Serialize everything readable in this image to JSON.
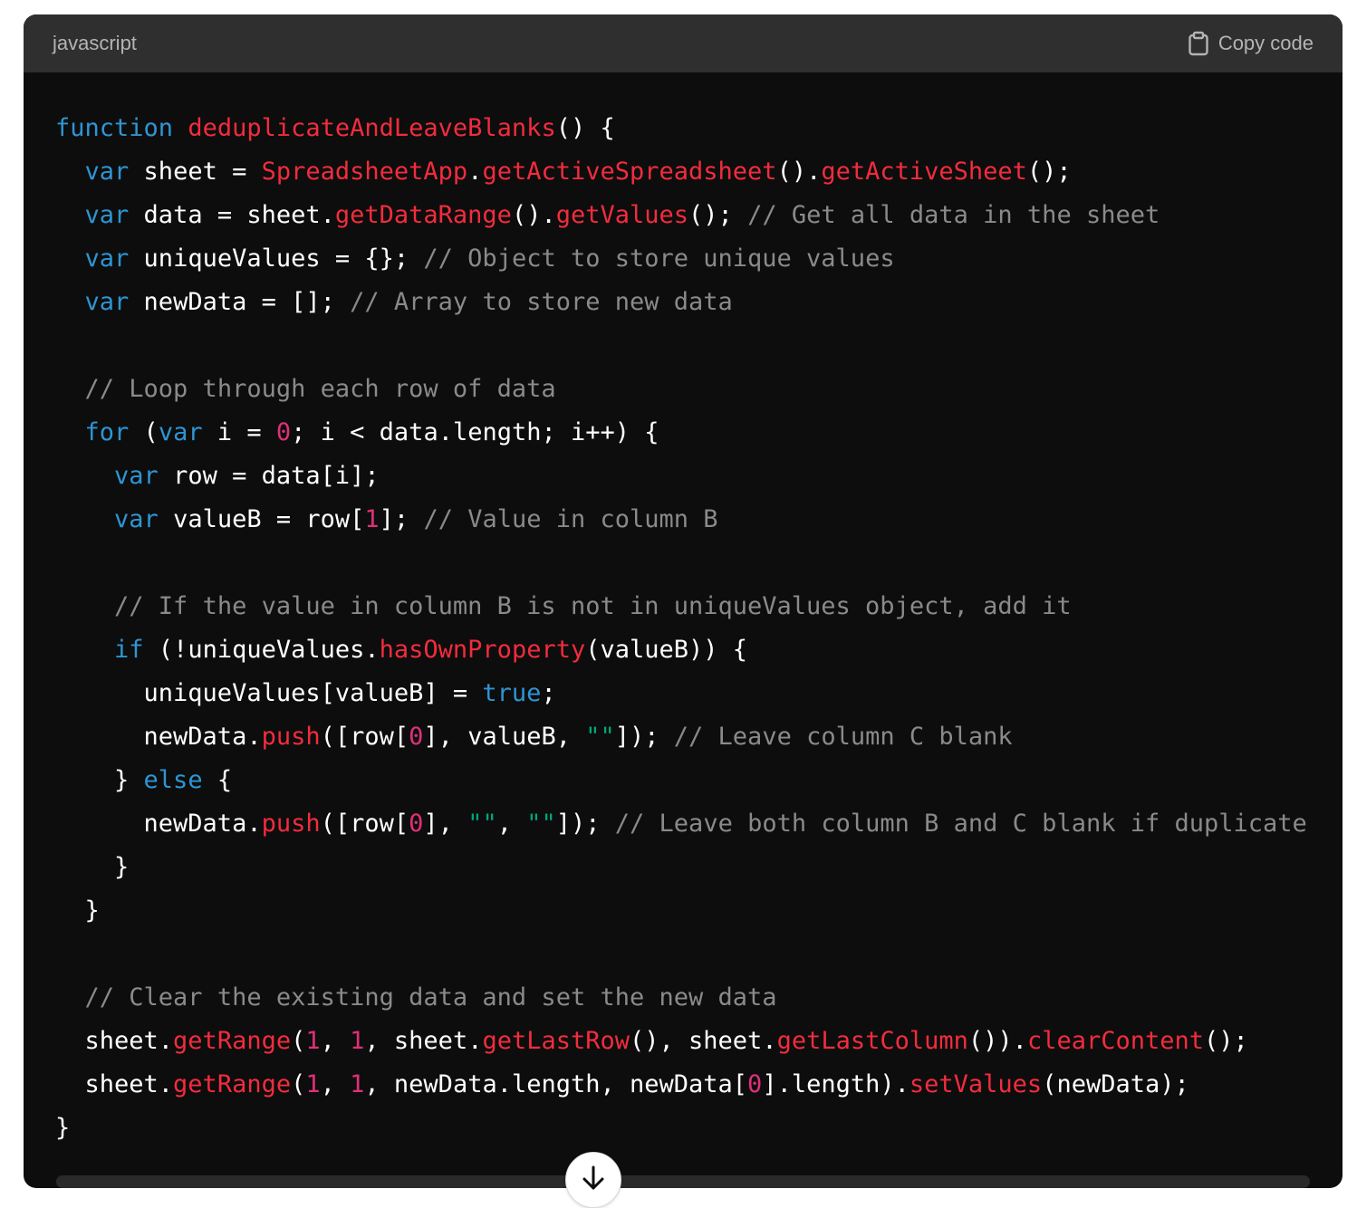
{
  "header": {
    "language": "javascript",
    "copy_label": "Copy code",
    "copy_icon": "clipboard-icon"
  },
  "colors": {
    "keyword": "#2e95d3",
    "function": "#f22c3d",
    "number": "#df3079",
    "string": "#00a67d",
    "comment": "#8a8a8a",
    "plain": "#ffffff",
    "header_bg": "#2f2f2f",
    "code_bg": "#0d0d0d"
  },
  "code_lines": [
    [
      [
        "kw",
        "function"
      ],
      [
        "p",
        " "
      ],
      [
        "fn",
        "deduplicateAndLeaveBlanks"
      ],
      [
        "p",
        "() {"
      ]
    ],
    [
      [
        "p",
        "  "
      ],
      [
        "kw",
        "var"
      ],
      [
        "p",
        " sheet = "
      ],
      [
        "fn",
        "SpreadsheetApp"
      ],
      [
        "p",
        "."
      ],
      [
        "fn",
        "getActiveSpreadsheet"
      ],
      [
        "p",
        "()."
      ],
      [
        "fn",
        "getActiveSheet"
      ],
      [
        "p",
        "();"
      ]
    ],
    [
      [
        "p",
        "  "
      ],
      [
        "kw",
        "var"
      ],
      [
        "p",
        " data = sheet."
      ],
      [
        "fn",
        "getDataRange"
      ],
      [
        "p",
        "()."
      ],
      [
        "fn",
        "getValues"
      ],
      [
        "p",
        "(); "
      ],
      [
        "com",
        "// Get all data in the sheet"
      ]
    ],
    [
      [
        "p",
        "  "
      ],
      [
        "kw",
        "var"
      ],
      [
        "p",
        " uniqueValues = {}; "
      ],
      [
        "com",
        "// Object to store unique values"
      ]
    ],
    [
      [
        "p",
        "  "
      ],
      [
        "kw",
        "var"
      ],
      [
        "p",
        " newData = []; "
      ],
      [
        "com",
        "// Array to store new data"
      ]
    ],
    [],
    [
      [
        "p",
        "  "
      ],
      [
        "com",
        "// Loop through each row of data"
      ]
    ],
    [
      [
        "p",
        "  "
      ],
      [
        "kw",
        "for"
      ],
      [
        "p",
        " ("
      ],
      [
        "kw",
        "var"
      ],
      [
        "p",
        " i = "
      ],
      [
        "num",
        "0"
      ],
      [
        "p",
        "; i < data.length; i++) {"
      ]
    ],
    [
      [
        "p",
        "    "
      ],
      [
        "kw",
        "var"
      ],
      [
        "p",
        " row = data[i];"
      ]
    ],
    [
      [
        "p",
        "    "
      ],
      [
        "kw",
        "var"
      ],
      [
        "p",
        " valueB = row["
      ],
      [
        "num",
        "1"
      ],
      [
        "p",
        "]; "
      ],
      [
        "com",
        "// Value in column B"
      ]
    ],
    [],
    [
      [
        "p",
        "    "
      ],
      [
        "com",
        "// If the value in column B is not in uniqueValues object, add it"
      ]
    ],
    [
      [
        "p",
        "    "
      ],
      [
        "kw",
        "if"
      ],
      [
        "p",
        " (!uniqueValues."
      ],
      [
        "fn",
        "hasOwnProperty"
      ],
      [
        "p",
        "(valueB)) {"
      ]
    ],
    [
      [
        "p",
        "      uniqueValues[valueB] = "
      ],
      [
        "kw",
        "true"
      ],
      [
        "p",
        ";"
      ]
    ],
    [
      [
        "p",
        "      newData."
      ],
      [
        "fn",
        "push"
      ],
      [
        "p",
        "([row["
      ],
      [
        "num",
        "0"
      ],
      [
        "p",
        "], valueB, "
      ],
      [
        "str",
        "\"\""
      ],
      [
        "p",
        "]); "
      ],
      [
        "com",
        "// Leave column C blank"
      ]
    ],
    [
      [
        "p",
        "    } "
      ],
      [
        "kw",
        "else"
      ],
      [
        "p",
        " {"
      ]
    ],
    [
      [
        "p",
        "      newData."
      ],
      [
        "fn",
        "push"
      ],
      [
        "p",
        "([row["
      ],
      [
        "num",
        "0"
      ],
      [
        "p",
        "], "
      ],
      [
        "str",
        "\"\""
      ],
      [
        "p",
        ", "
      ],
      [
        "str",
        "\"\""
      ],
      [
        "p",
        "]); "
      ],
      [
        "com",
        "// Leave both column B and C blank if duplicate"
      ]
    ],
    [
      [
        "p",
        "    }"
      ]
    ],
    [
      [
        "p",
        "  }"
      ]
    ],
    [],
    [
      [
        "p",
        "  "
      ],
      [
        "com",
        "// Clear the existing data and set the new data"
      ]
    ],
    [
      [
        "p",
        "  sheet."
      ],
      [
        "fn",
        "getRange"
      ],
      [
        "p",
        "("
      ],
      [
        "num",
        "1"
      ],
      [
        "p",
        ", "
      ],
      [
        "num",
        "1"
      ],
      [
        "p",
        ", sheet."
      ],
      [
        "fn",
        "getLastRow"
      ],
      [
        "p",
        "(), sheet."
      ],
      [
        "fn",
        "getLastColumn"
      ],
      [
        "p",
        "())."
      ],
      [
        "fn",
        "clearContent"
      ],
      [
        "p",
        "();"
      ]
    ],
    [
      [
        "p",
        "  sheet."
      ],
      [
        "fn",
        "getRange"
      ],
      [
        "p",
        "("
      ],
      [
        "num",
        "1"
      ],
      [
        "p",
        ", "
      ],
      [
        "num",
        "1"
      ],
      [
        "p",
        ", newData.length, newData["
      ],
      [
        "num",
        "0"
      ],
      [
        "p",
        "].length)."
      ],
      [
        "fn",
        "setValues"
      ],
      [
        "p",
        "(newData);"
      ]
    ],
    [
      [
        "p",
        "}"
      ]
    ]
  ],
  "scroll_button_icon": "arrow-down-icon"
}
